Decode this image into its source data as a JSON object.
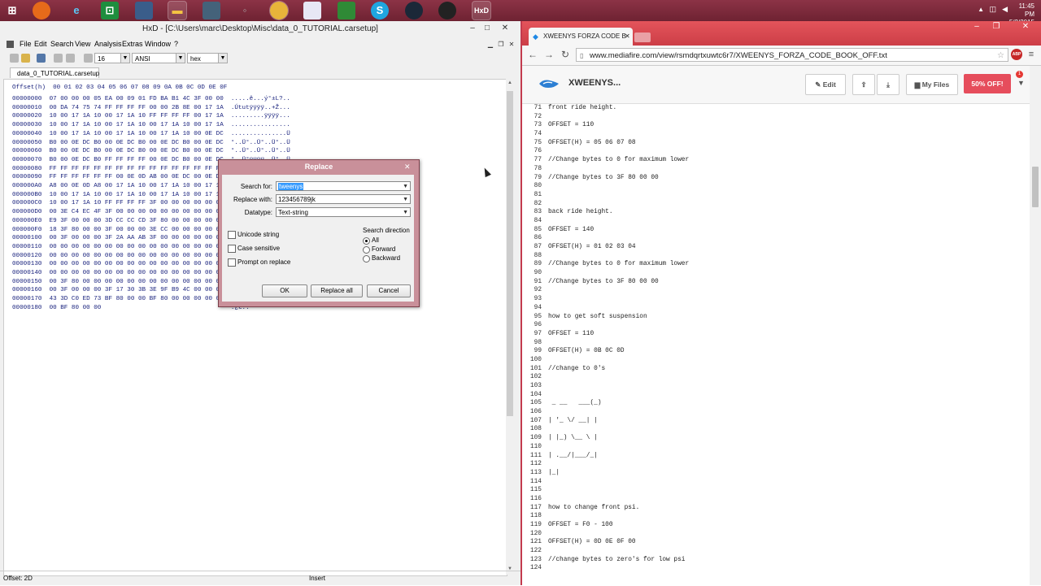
{
  "taskbar": {
    "clock_time": "11:45 PM",
    "clock_date": "5/2/2015",
    "icons": [
      "windows-start-icon",
      "firefox-icon",
      "ie-icon",
      "excel-icon",
      "app-icon",
      "explorer-icon",
      "app-icon",
      "app-icon",
      "chrome-icon",
      "doc-icon",
      "spreadsheet-icon",
      "skype-icon",
      "steam-icon",
      "obs-icon",
      "hxd-icon"
    ]
  },
  "hxd": {
    "title": "HxD - [C:\\Users\\marc\\Desktop\\Misc\\data_0_TUTORIAL.carsetup]",
    "menu": [
      "File",
      "Edit",
      "Search",
      "View",
      "Analysis",
      "Extras",
      "Window",
      "?"
    ],
    "toolbar": {
      "bytes_per_row": "16",
      "charset": "ANSI",
      "offset_base": "hex"
    },
    "tab": "data_0_TUTORIAL.carsetup",
    "hex_header": "Offset(h)  00 01 02 03 04 05 06 07 08 09 0A 0B 0C 0D 0E 0F",
    "rows": [
      "00000000  07 00 00 00 05 EA 00 09 01 FD BA B1 4C 3F 00 00  .....ê...ý°±L?..",
      "00000010  00 DA 74 75 74 FF FF FF FF 00 00 2B 8E 00 17 1A  .Útutÿÿÿÿ..+Ž...",
      "00000020  10 00 17 1A 10 00 17 1A 10 FF FF FF FF 00 17 1A  .........ÿÿÿÿ...",
      "00000030  10 00 17 1A 10 00 17 1A 10 00 17 1A 10 00 17 1A  ................",
      "00000040  10 00 17 1A 10 00 17 1A 10 00 17 1A 10 00 0E DC  ...............Ü",
      "00000050  B0 00 0E DC B0 00 0E DC B0 00 0E DC B0 00 0E DC  °..Ü°..Ü°..Ü°..Ü",
      "00000060  B0 00 0E DC B0 00 0E DC B0 00 0E DC B0 00 0E DC  °..Ü°..Ü°..Ü°..Ü",
      "00000070  B0 00 0E DC B0 FF FF FF FF 00 0E DC B0 00 0E DC  °..Ü°ÿÿÿÿ..Ü°..Ü",
      "00000080  FF FF FF FF FF FF FF FF FF FF FF FF FF FF FF FF  ÿÿÿÿÿÿÿÿÿÿÿÿÿÿÿÿ",
      "00000090  FF FF FF FF FF FF 00 0E 0D AB 00 0E DC 00 0E DC  ÿÿÿÿÿÿ...«..Ü..Ü",
      "000000A0  A8 00 0E 0D A8 00 17 1A 10 00 17 1A 10 00 17 1A  ¨...¨...........",
      "000000B0  10 00 17 1A 10 00 17 1A 10 00 17 1A 10 00 17 1A  ................",
      "000000C0  10 00 17 1A 10 FF FF FF FF 3F 00 00 00 00 00 00  .....ÿÿÿÿ?......",
      "000000D0  00 3E C4 EC 4F 3F 00 00 00 00 00 00 00 00 00 00  .>ÄìO?..........",
      "000000E0  E9 3F 00 00 00 3D CC CC CD 3F 80 00 00 00 00 00  é?...=ÌÌÍ?€.....",
      "000000F0  18 3F 80 00 00 3F 00 00 00 3E CC 00 00 00 00 00  .?€..?...>Ì.....",
      "00000100  00 3F 00 00 00 3F 2A AA AB 3F 00 00 00 00 00 00  .?...?*ª«?......",
      "00000110  00 00 00 00 00 00 00 00 00 00 00 00 00 00 00 00  ................",
      "00000120  00 00 00 00 00 00 00 00 00 00 00 00 00 00 00 00  ................",
      "00000130  00 00 00 00 00 00 00 00 00 00 00 00 00 00 00 00  ................",
      "00000140  00 00 00 00 00 00 00 00 00 00 00 00 00 00 00 00  ................",
      "00000150  00 3F 80 00 00 00 00 00 00 00 00 00 00 00 00 00  .?€.............",
      "00000160  00 3F 00 00 00 3F 17 30 3B 3E 9F B9 4C 00 00 00  .?...?.0;>Ÿ¹L...",
      "00000170  43 3D C0 ED 73 BF 80 00 00 BF 80 00 00 00 00 00  C=Àís¿€..¿€.....",
      "00000180  00 BF 80 00 00                                   .¿€.."
    ],
    "status_offset": "Offset: 2D",
    "status_mode": "Insert"
  },
  "dialog": {
    "title": "Replace",
    "search_label": "Search for:",
    "search_value": "tweenys",
    "replace_label": "Replace with:",
    "replace_value": "123456789jk",
    "datatype_label": "Datatype:",
    "datatype_value": "Text-string",
    "unicode_label": "Unicode string",
    "case_label": "Case sensitive",
    "prompt_label": "Prompt on replace",
    "direction_label": "Search direction",
    "dir_all": "All",
    "dir_forward": "Forward",
    "dir_backward": "Backward",
    "ok": "OK",
    "replace_all": "Replace all",
    "cancel": "Cancel"
  },
  "chrome": {
    "tab_title": "XWEENYS FORZA CODE B",
    "url": "www.mediafire.com/view/rsmdqrtxuwtc6r7/XWEENYS_FORZA_CODE_BOOK_OFF.txt",
    "abp": "ABP"
  },
  "mediafire": {
    "user": "XWEENYS...",
    "edit": "Edit",
    "my_files": "My Files",
    "offer": "50% OFF!",
    "badge": "1"
  },
  "document": {
    "lines": [
      {
        "n": "71",
        "t": "front ride height."
      },
      {
        "n": "72",
        "t": ""
      },
      {
        "n": "73",
        "t": "OFFSET = 110"
      },
      {
        "n": "74",
        "t": ""
      },
      {
        "n": "75",
        "t": "OFFSET(H) = 05 06 07 08"
      },
      {
        "n": "76",
        "t": ""
      },
      {
        "n": "77",
        "t": "//Change bytes to 0 for maximum lower"
      },
      {
        "n": "78",
        "t": ""
      },
      {
        "n": "79",
        "t": "//Change bytes to 3F 80 00 00"
      },
      {
        "n": "80",
        "t": ""
      },
      {
        "n": "81",
        "t": ""
      },
      {
        "n": "82",
        "t": ""
      },
      {
        "n": "83",
        "t": "back ride height."
      },
      {
        "n": "84",
        "t": ""
      },
      {
        "n": "85",
        "t": "OFFSET = 140"
      },
      {
        "n": "86",
        "t": ""
      },
      {
        "n": "87",
        "t": "OFFSET(H) = 01 02 03 04"
      },
      {
        "n": "88",
        "t": ""
      },
      {
        "n": "89",
        "t": "//Change bytes to 0 for maximum lower"
      },
      {
        "n": "90",
        "t": ""
      },
      {
        "n": "91",
        "t": "//Change bytes to 3F 80 00 00"
      },
      {
        "n": "92",
        "t": ""
      },
      {
        "n": "93",
        "t": ""
      },
      {
        "n": "94",
        "t": ""
      },
      {
        "n": "95",
        "t": "how to get soft suspension"
      },
      {
        "n": "96",
        "t": ""
      },
      {
        "n": "97",
        "t": "OFFSET = 110"
      },
      {
        "n": "98",
        "t": ""
      },
      {
        "n": "99",
        "t": "OFFSET(H) = 0B 0C 0D"
      },
      {
        "n": "100",
        "t": ""
      },
      {
        "n": "101",
        "t": "//change to 0's"
      },
      {
        "n": "102",
        "t": ""
      },
      {
        "n": "103",
        "t": ""
      },
      {
        "n": "104",
        "t": ""
      },
      {
        "n": "105",
        "t": " _ __   ___(_)"
      },
      {
        "n": "106",
        "t": ""
      },
      {
        "n": "107",
        "t": "| '_ \\/ __| |"
      },
      {
        "n": "108",
        "t": ""
      },
      {
        "n": "109",
        "t": "| |_) \\__ \\ |"
      },
      {
        "n": "110",
        "t": ""
      },
      {
        "n": "111",
        "t": "| .__/|___/_|"
      },
      {
        "n": "112",
        "t": ""
      },
      {
        "n": "113",
        "t": "|_|"
      },
      {
        "n": "114",
        "t": ""
      },
      {
        "n": "115",
        "t": ""
      },
      {
        "n": "116",
        "t": ""
      },
      {
        "n": "117",
        "t": "how to change front psi."
      },
      {
        "n": "118",
        "t": ""
      },
      {
        "n": "119",
        "t": "OFFSET = F0 - 100"
      },
      {
        "n": "120",
        "t": ""
      },
      {
        "n": "121",
        "t": "OFFSET(H) = 0D 0E 0F 00"
      },
      {
        "n": "122",
        "t": ""
      },
      {
        "n": "123",
        "t": "//change bytes to zero's for low psi"
      },
      {
        "n": "124",
        "t": ""
      }
    ]
  }
}
